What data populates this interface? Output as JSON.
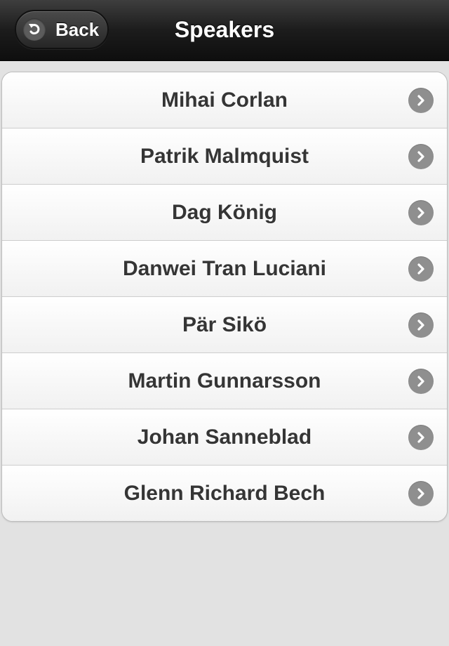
{
  "header": {
    "title": "Speakers",
    "back_label": "Back"
  },
  "speakers": [
    {
      "name": "Mihai Corlan"
    },
    {
      "name": "Patrik Malmquist"
    },
    {
      "name": "Dag König"
    },
    {
      "name": "Danwei Tran Luciani"
    },
    {
      "name": "Pär Sikö"
    },
    {
      "name": "Martin Gunnarsson"
    },
    {
      "name": "Johan Sanneblad"
    },
    {
      "name": "Glenn Richard Bech"
    }
  ],
  "icons": {
    "back": "back-arrow-icon",
    "row": "chevron-right-icon"
  },
  "colors": {
    "header": "#1c1c1c",
    "background": "#e2e2e2",
    "chevron_badge": "#8f8f8f",
    "label": "#353535"
  }
}
